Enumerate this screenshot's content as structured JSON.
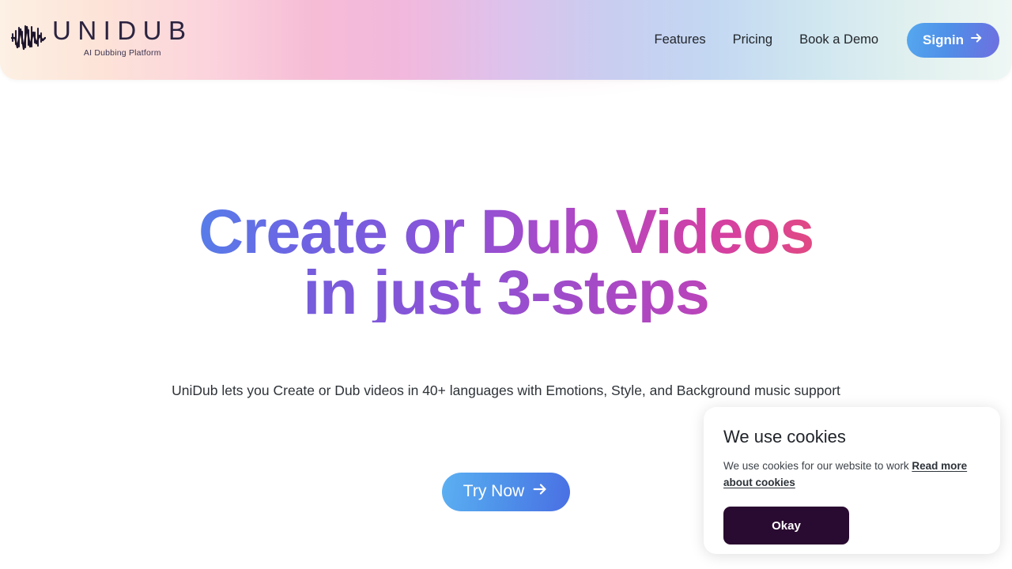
{
  "brand": {
    "name": "UNIDUB",
    "tagline": "AI Dubbing Platform",
    "logo_icon": "audio-waveform-icon"
  },
  "header": {
    "nav": [
      {
        "label": "Features"
      },
      {
        "label": "Pricing"
      },
      {
        "label": "Book a Demo"
      }
    ],
    "signin": {
      "label": "Signin",
      "icon": "arrow-right-icon"
    },
    "gradient_stops": [
      "#fdf0e4",
      "#fbd3dd",
      "#f2b8dd",
      "#ddc2ec",
      "#c3d7f2",
      "#eef7f4"
    ]
  },
  "hero": {
    "headline_line1": "Create or Dub Videos",
    "headline_line2": "in just 3-steps",
    "headline_gradient": [
      "#3fa0f0",
      "#6d63e2",
      "#b247c4",
      "#d6409f",
      "#f4784f"
    ],
    "subtitle": "UniDub lets you Create or Dub videos in 40+ languages with Emotions, Style, and Background music support",
    "cta": {
      "label": "Try Now",
      "icon": "arrow-right-icon",
      "color": "#4e92ea"
    }
  },
  "cookie_banner": {
    "title": "We use cookies",
    "body_text": "We use cookies for our website to work ",
    "link_text": "Read more about cookies",
    "accept_label": "Okay",
    "accept_color": "#290a30"
  }
}
